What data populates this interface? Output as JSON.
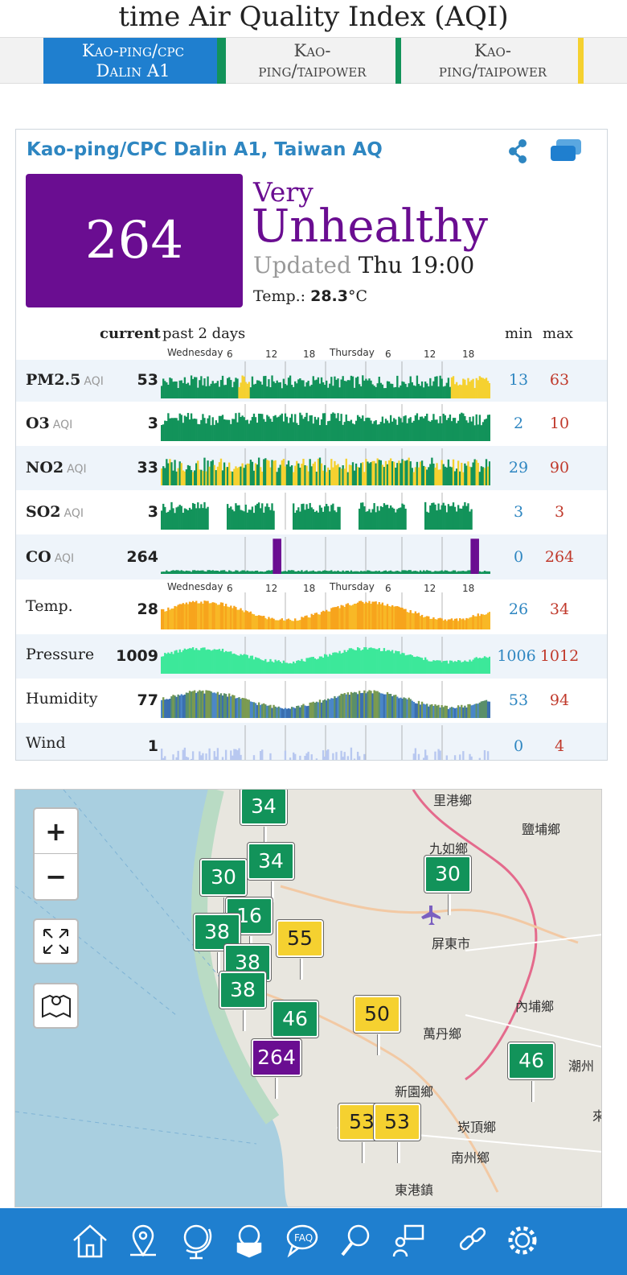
{
  "header": {
    "title": "time Air Quality Index (AQI)"
  },
  "tabs": [
    {
      "line1": "Kao-ping/cpc",
      "line2": "Dalin A1",
      "active": true,
      "stripe": "#12935a"
    },
    {
      "line1": "Kao-",
      "line2": "ping/taipower",
      "active": false,
      "stripe": "#12935a"
    },
    {
      "line1": "Kao-",
      "line2": "ping/taipower",
      "active": false,
      "stripe": "#f5d130"
    }
  ],
  "station": {
    "title": "Kao-ping/CPC Dalin A1, Taiwan AQ",
    "aqi": "264",
    "level_line1": "Very",
    "level_line2": "Unhealthy",
    "updated_label": "Updated",
    "updated_time": "Thu 19:00",
    "temp_label": "Temp.:",
    "temp_value": "28.3",
    "temp_unit": "°C",
    "aqi_color": "#6a0d91"
  },
  "history": {
    "col_current": "current",
    "col_past": "past 2 days",
    "col_min": "min",
    "col_max": "max",
    "axis_top": [
      "Wednesday",
      "6",
      "12",
      "18",
      "Thursday",
      "6",
      "12",
      "18"
    ],
    "axis_mid": [
      "Wednesday",
      "6",
      "12",
      "18",
      "Thursday",
      "6",
      "12",
      "18"
    ],
    "rows": [
      {
        "label": "PM2.5",
        "aqi_tag": "AQI",
        "current": "53",
        "min": "13",
        "max": "63"
      },
      {
        "label": "O3",
        "aqi_tag": "AQI",
        "current": "3",
        "min": "2",
        "max": "10"
      },
      {
        "label": "NO2",
        "aqi_tag": "AQI",
        "current": "33",
        "min": "29",
        "max": "90"
      },
      {
        "label": "SO2",
        "aqi_tag": "AQI",
        "current": "3",
        "min": "3",
        "max": "3"
      },
      {
        "label": "CO",
        "aqi_tag": "AQI",
        "current": "264",
        "min": "0",
        "max": "264"
      },
      {
        "label": "Temp.",
        "aqi_tag": "",
        "current": "28",
        "min": "26",
        "max": "34"
      },
      {
        "label": "Pressure",
        "aqi_tag": "",
        "current": "1009",
        "min": "1006",
        "max": "1012"
      },
      {
        "label": "Humidity",
        "aqi_tag": "",
        "current": "77",
        "min": "53",
        "max": "94"
      },
      {
        "label": "Wind",
        "aqi_tag": "",
        "current": "1",
        "min": "0",
        "max": "4"
      }
    ]
  },
  "map": {
    "zoom_in": "+",
    "zoom_out": "−",
    "markers": [
      {
        "value": "34",
        "color": "green"
      },
      {
        "value": "34",
        "color": "green"
      },
      {
        "value": "30",
        "color": "green"
      },
      {
        "value": "30",
        "color": "green"
      },
      {
        "value": "16",
        "color": "green"
      },
      {
        "value": "38",
        "color": "green"
      },
      {
        "value": "55",
        "color": "yellow"
      },
      {
        "value": "38",
        "color": "green"
      },
      {
        "value": "38",
        "color": "green"
      },
      {
        "value": "46",
        "color": "green"
      },
      {
        "value": "50",
        "color": "yellow"
      },
      {
        "value": "264",
        "color": "purple"
      },
      {
        "value": "46",
        "color": "green"
      },
      {
        "value": "53",
        "color": "yellow"
      },
      {
        "value": "53",
        "color": "yellow"
      }
    ],
    "places": [
      "里港鄉",
      "鹽埔鄉",
      "九如鄉",
      "屏東市",
      "內埔鄉",
      "萬丹鄉",
      "新園鄉",
      "崁頂鄉",
      "南州鄉",
      "東港鎮",
      "潮州",
      "來"
    ]
  },
  "nav": [
    "home-icon",
    "map-pin-icon",
    "globe-icon",
    "mask-icon",
    "faq-icon",
    "search-icon",
    "feedback-icon",
    "link-icon",
    "gear-icon"
  ]
}
